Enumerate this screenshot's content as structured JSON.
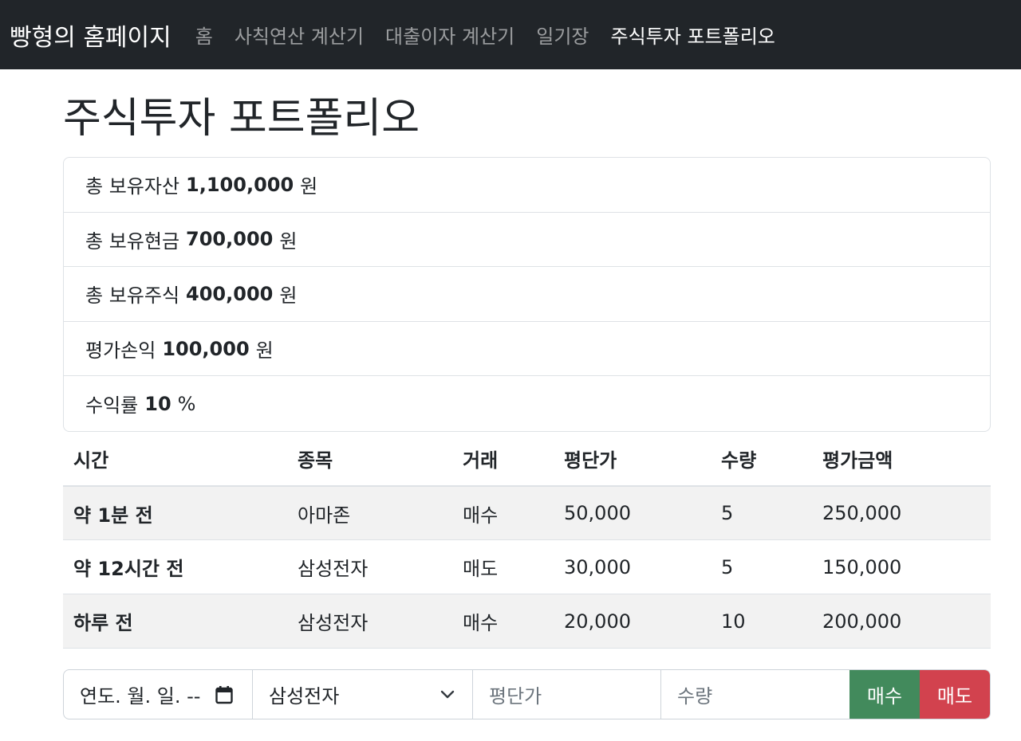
{
  "nav": {
    "brand": "빵형의 홈페이지",
    "links": [
      {
        "label": "홈",
        "active": false
      },
      {
        "label": "사칙연산 계산기",
        "active": false
      },
      {
        "label": "대출이자 계산기",
        "active": false
      },
      {
        "label": "일기장",
        "active": false
      },
      {
        "label": "주식투자 포트폴리오",
        "active": true
      }
    ]
  },
  "page": {
    "title": "주식투자 포트폴리오"
  },
  "summary": [
    {
      "label": "총 보유자산",
      "value": "1,100,000",
      "unit": "원"
    },
    {
      "label": "총 보유현금",
      "value": "700,000",
      "unit": "원"
    },
    {
      "label": "총 보유주식",
      "value": "400,000",
      "unit": "원"
    },
    {
      "label": "평가손익",
      "value": "100,000",
      "unit": "원"
    },
    {
      "label": "수익률",
      "value": "10",
      "unit": "%"
    }
  ],
  "table": {
    "headers": [
      "시간",
      "종목",
      "거래",
      "평단가",
      "수량",
      "평가금액"
    ],
    "rows": [
      {
        "time": "약 1분 전",
        "stock": "아마존",
        "type": "매수",
        "price": "50,000",
        "qty": "5",
        "amount": "250,000"
      },
      {
        "time": "약 12시간 전",
        "stock": "삼성전자",
        "type": "매도",
        "price": "30,000",
        "qty": "5",
        "amount": "150,000"
      },
      {
        "time": "하루 전",
        "stock": "삼성전자",
        "type": "매수",
        "price": "20,000",
        "qty": "10",
        "amount": "200,000"
      }
    ]
  },
  "form": {
    "date_placeholder": "연도. 월. 일. --",
    "date_icon": "calendar-icon",
    "stock_selected": "삼성전자",
    "select_icon": "chevron-down-icon",
    "price_placeholder": "평단가",
    "qty_placeholder": "수량",
    "buy_label": "매수",
    "sell_label": "매도"
  },
  "colors": {
    "navbar_bg": "#212529",
    "buy_button": "#428a5c",
    "sell_button": "#d2424e",
    "row_stripe": "#f2f2f2"
  }
}
